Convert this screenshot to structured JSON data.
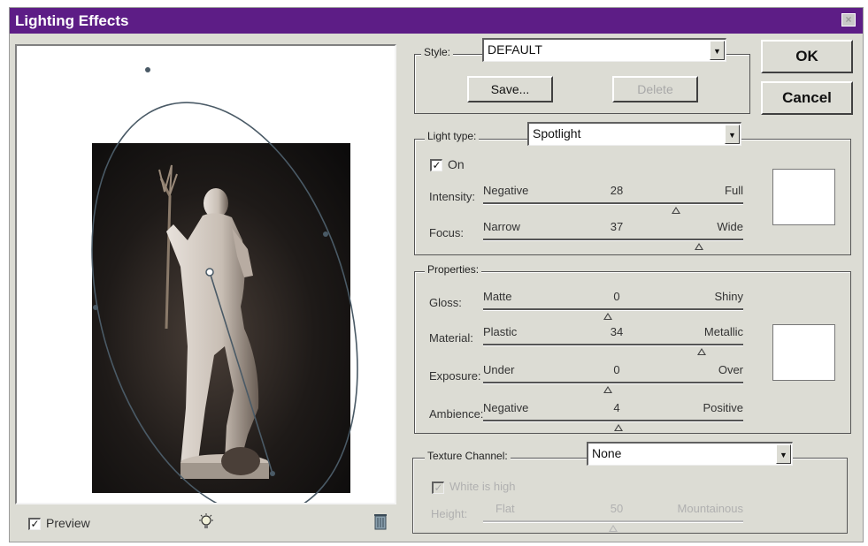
{
  "dialog": {
    "title": "Lighting Effects",
    "close_glyph": "×"
  },
  "colors": {
    "titlebar": "#5d1d86",
    "face": "#dcdcd4"
  },
  "style": {
    "label": "Style:",
    "value": "DEFAULT",
    "save_label": "Save...",
    "delete_label": "Delete"
  },
  "buttons": {
    "ok": "OK",
    "cancel": "Cancel"
  },
  "light_type": {
    "label": "Light type:",
    "value": "Spotlight",
    "on_label": "On",
    "on_checked": true,
    "intensity": {
      "label": "Intensity:",
      "left": "Negative",
      "value": "28",
      "right": "Full",
      "level": 0.74
    },
    "focus": {
      "label": "Focus:",
      "left": "Narrow",
      "value": "37",
      "right": "Wide",
      "level": 0.83
    }
  },
  "properties": {
    "label": "Properties:",
    "gloss": {
      "label": "Gloss:",
      "left": "Matte",
      "value": "0",
      "right": "Shiny",
      "level": 0.48
    },
    "material": {
      "label": "Material:",
      "left": "Plastic",
      "value": "34",
      "right": "Metallic",
      "level": 0.84
    },
    "exposure": {
      "label": "Exposure:",
      "left": "Under",
      "value": "0",
      "right": "Over",
      "level": 0.48
    },
    "ambience": {
      "label": "Ambience:",
      "left": "Negative",
      "value": "4",
      "right": "Positive",
      "level": 0.52
    }
  },
  "texture": {
    "label": "Texture Channel:",
    "value": "None",
    "white_is_high_label": "White is high",
    "white_is_high_checked": true,
    "height": {
      "label": "Height:",
      "left": "Flat",
      "value": "50",
      "right": "Mountainous",
      "level": 0.5
    }
  },
  "preview": {
    "label": "Preview",
    "checked": true
  },
  "icons": {
    "new_light": "light-bulb-icon",
    "delete_light": "trash-icon"
  }
}
